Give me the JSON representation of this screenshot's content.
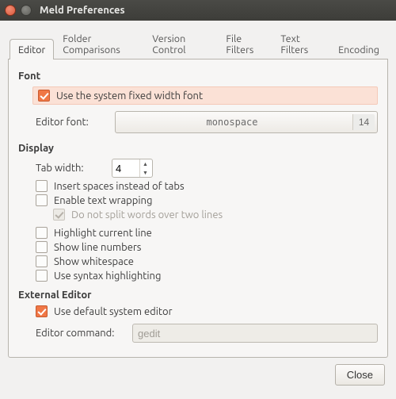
{
  "window": {
    "title": "Meld Preferences"
  },
  "tabs": [
    {
      "label": "Editor",
      "active": true
    },
    {
      "label": "Folder Comparisons",
      "active": false
    },
    {
      "label": "Version Control",
      "active": false
    },
    {
      "label": "File Filters",
      "active": false
    },
    {
      "label": "Text Filters",
      "active": false
    },
    {
      "label": "Encoding",
      "active": false
    }
  ],
  "font": {
    "section": "Font",
    "use_system_label": "Use the system fixed width font",
    "use_system_checked": true,
    "editor_font_label": "Editor font:",
    "font_name": "monospace",
    "font_size": "14"
  },
  "display": {
    "section": "Display",
    "tab_width_label": "Tab width:",
    "tab_width_value": "4",
    "insert_spaces_label": "Insert spaces instead of tabs",
    "insert_spaces_checked": false,
    "wrap_label": "Enable text wrapping",
    "wrap_checked": false,
    "nosplit_label": "Do not split words over two lines",
    "nosplit_checked": true,
    "highlight_label": "Highlight current line",
    "highlight_checked": false,
    "linenums_label": "Show line numbers",
    "linenums_checked": false,
    "whitespace_label": "Show whitespace",
    "whitespace_checked": false,
    "syntax_label": "Use syntax highlighting",
    "syntax_checked": false
  },
  "external": {
    "section": "External Editor",
    "default_label": "Use default system editor",
    "default_checked": true,
    "command_label": "Editor command:",
    "command_value": "gedit"
  },
  "footer": {
    "close": "Close"
  }
}
